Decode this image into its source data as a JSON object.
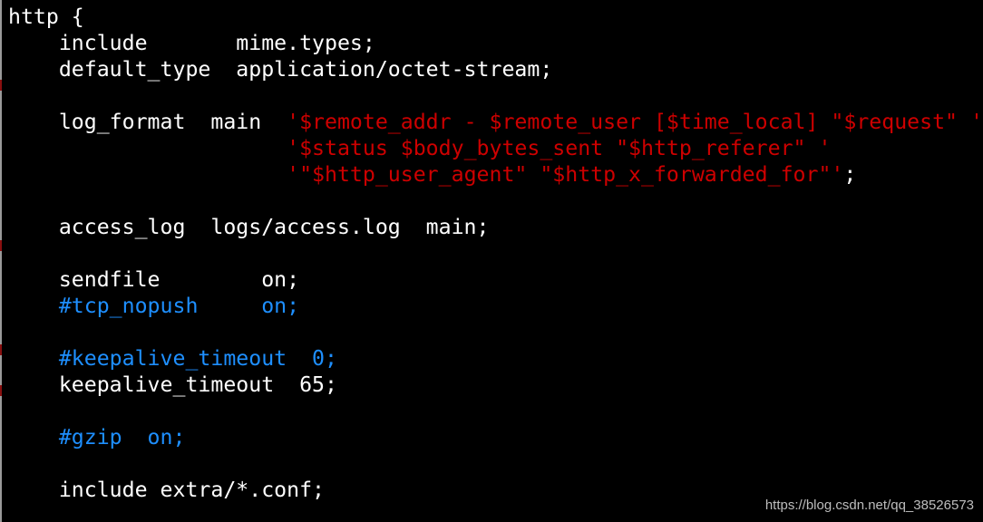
{
  "colors": {
    "default": "#ffffff",
    "string": "#cd0000",
    "comment": "#1e8fff",
    "background": "#000000"
  },
  "lines": [
    [
      {
        "t": "http {",
        "c": "w"
      }
    ],
    [
      {
        "t": "    include       mime.types;",
        "c": "w"
      }
    ],
    [
      {
        "t": "    default_type  application/octet-stream;",
        "c": "w"
      }
    ],
    [],
    [
      {
        "t": "    log_format  main  ",
        "c": "w"
      },
      {
        "t": "'$remote_addr - $remote_user [$time_local] \"$request\" '",
        "c": "r"
      }
    ],
    [
      {
        "t": "                      ",
        "c": "w"
      },
      {
        "t": "'$status $body_bytes_sent \"$http_referer\" '",
        "c": "r"
      }
    ],
    [
      {
        "t": "                      ",
        "c": "w"
      },
      {
        "t": "'\"$http_user_agent\" \"$http_x_forwarded_for\"'",
        "c": "r"
      },
      {
        "t": ";",
        "c": "w"
      }
    ],
    [],
    [
      {
        "t": "    access_log  logs/access.log  main;",
        "c": "w"
      }
    ],
    [],
    [
      {
        "t": "    sendfile        on;",
        "c": "w"
      }
    ],
    [
      {
        "t": "    #tcp_nopush     on;",
        "c": "b"
      }
    ],
    [],
    [
      {
        "t": "    #keepalive_timeout  0;",
        "c": "b"
      }
    ],
    [
      {
        "t": "    keepalive_timeout  65;",
        "c": "w"
      }
    ],
    [],
    [
      {
        "t": "    #gzip  on;",
        "c": "b"
      }
    ],
    [],
    [
      {
        "t": "    include extra/*.conf;",
        "c": "w"
      }
    ]
  ],
  "watermark": "https://blog.csdn.net/qq_38526573"
}
